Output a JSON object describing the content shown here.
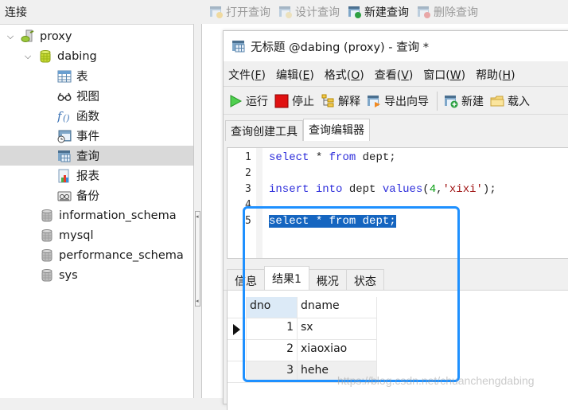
{
  "left_pane": {
    "header": "连接",
    "tree": [
      {
        "label": "proxy",
        "level": 0,
        "icon": "connection-icon",
        "expanded": true
      },
      {
        "label": "dabing",
        "level": 1,
        "icon": "database-open-icon",
        "expanded": true
      },
      {
        "label": "表",
        "level": 2,
        "icon": "table-icon"
      },
      {
        "label": "视图",
        "level": 2,
        "icon": "view-icon"
      },
      {
        "label": "函数",
        "level": 2,
        "icon": "function-icon"
      },
      {
        "label": "事件",
        "level": 2,
        "icon": "event-icon"
      },
      {
        "label": "查询",
        "level": 2,
        "icon": "query-icon",
        "selected": true
      },
      {
        "label": "报表",
        "level": 2,
        "icon": "report-icon"
      },
      {
        "label": "备份",
        "level": 2,
        "icon": "backup-icon"
      },
      {
        "label": "information_schema",
        "level": 1,
        "icon": "database-icon"
      },
      {
        "label": "mysql",
        "level": 1,
        "icon": "database-icon"
      },
      {
        "label": "performance_schema",
        "level": 1,
        "icon": "database-icon"
      },
      {
        "label": "sys",
        "level": 1,
        "icon": "database-icon"
      }
    ]
  },
  "object_toolbar": {
    "buttons": [
      {
        "label": "打开查询",
        "icon": "open-query-icon",
        "enabled": false
      },
      {
        "label": "设计查询",
        "icon": "design-query-icon",
        "enabled": false
      },
      {
        "label": "新建查询",
        "icon": "new-query-icon",
        "enabled": true
      },
      {
        "label": "删除查询",
        "icon": "delete-query-icon",
        "enabled": false
      }
    ]
  },
  "query_window": {
    "title": "无标题 @dabing (proxy) - 查询 *",
    "menu": [
      {
        "label": "文件",
        "key": "F"
      },
      {
        "label": "编辑",
        "key": "E"
      },
      {
        "label": "格式",
        "key": "O"
      },
      {
        "label": "查看",
        "key": "V"
      },
      {
        "label": "窗口",
        "key": "W"
      },
      {
        "label": "帮助",
        "key": "H"
      }
    ],
    "toolbar": {
      "run": "运行",
      "stop": "停止",
      "explain": "解释",
      "export_wizard": "导出向导",
      "new": "新建",
      "load": "载入"
    },
    "editor_tabs": [
      {
        "label": "查询创建工具",
        "active": false
      },
      {
        "label": "查询编辑器",
        "active": true
      }
    ],
    "code_lines": [
      {
        "no": "1",
        "tokens": [
          [
            "kw",
            "select"
          ],
          [
            "plain",
            " * "
          ],
          [
            "kw",
            "from"
          ],
          [
            "plain",
            " dept;"
          ]
        ]
      },
      {
        "no": "2",
        "tokens": []
      },
      {
        "no": "3",
        "tokens": [
          [
            "kw",
            "insert"
          ],
          [
            "plain",
            " "
          ],
          [
            "kw",
            "into"
          ],
          [
            "plain",
            " dept "
          ],
          [
            "kw",
            "values"
          ],
          [
            "plain",
            "("
          ],
          [
            "num",
            "4"
          ],
          [
            "plain",
            ","
          ],
          [
            "str",
            "'xixi'"
          ],
          [
            "plain",
            ");"
          ]
        ]
      },
      {
        "no": "4",
        "tokens": []
      },
      {
        "no": "5",
        "tokens": [
          [
            "kw",
            "select"
          ],
          [
            "plain",
            " * "
          ],
          [
            "kw",
            "from"
          ],
          [
            "plain",
            " dept;"
          ]
        ],
        "selected": true
      }
    ],
    "result_tabs": [
      {
        "label": "信息",
        "active": false
      },
      {
        "label": "结果1",
        "active": true
      },
      {
        "label": "概况",
        "active": false
      },
      {
        "label": "状态",
        "active": false
      }
    ],
    "result_grid": {
      "columns": [
        "dno",
        "dname"
      ],
      "rows": [
        {
          "dno": "1",
          "dname": "sx",
          "current": true
        },
        {
          "dno": "2",
          "dname": "xiaoxiao"
        },
        {
          "dno": "3",
          "dname": "hehe"
        }
      ]
    }
  },
  "annotation_color": "#1e90ff",
  "watermark": "https://blog.csdn.net/chuanchengdabing"
}
